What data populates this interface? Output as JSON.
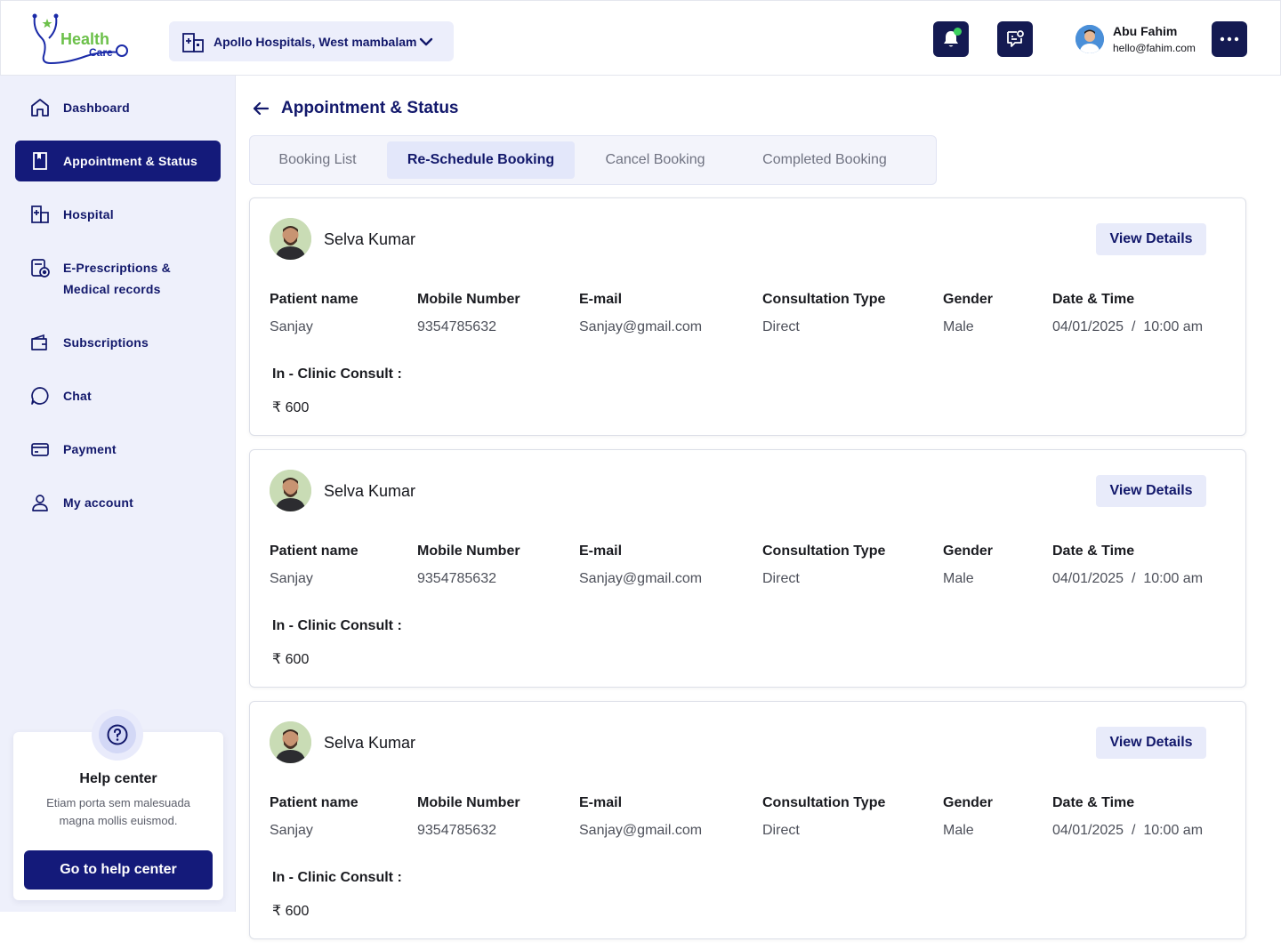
{
  "brand": {
    "name_line1": "Health",
    "name_line2": "Care"
  },
  "header": {
    "hospital": "Apollo Hospitals, West mambalam",
    "user_name": "Abu Fahim",
    "user_email": "hello@fahim.com"
  },
  "sidebar": {
    "items": [
      {
        "label": "Dashboard",
        "icon": "home-icon"
      },
      {
        "label": "Appointment & Status",
        "icon": "bookmark-icon",
        "active": true
      },
      {
        "label": "Hospital",
        "icon": "hospital-icon"
      },
      {
        "label": "E-Prescriptions & Medical records",
        "icon": "prescription-icon"
      },
      {
        "label": "Subscriptions",
        "icon": "wallet-icon"
      },
      {
        "label": "Chat",
        "icon": "chat-icon"
      },
      {
        "label": "Payment",
        "icon": "card-icon"
      },
      {
        "label": "My account",
        "icon": "user-icon"
      }
    ],
    "help": {
      "title": "Help center",
      "description": "Etiam porta sem malesuada magna mollis euismod.",
      "button": "Go to help center"
    }
  },
  "main": {
    "title": "Appointment & Status",
    "tabs": [
      {
        "label": "Booking List"
      },
      {
        "label": "Re-Schedule Booking",
        "active": true
      },
      {
        "label": "Cancel Booking"
      },
      {
        "label": "Completed Booking"
      }
    ],
    "labels": {
      "patient_name": "Patient name",
      "mobile": "Mobile Number",
      "email": "E-mail",
      "consult_type": "Consultation Type",
      "gender": "Gender",
      "datetime": "Date & Time",
      "clinic_consult": "In - Clinic Consult :",
      "view_details": "View Details",
      "currency": "₹"
    },
    "bookings": [
      {
        "doctor": "Selva Kumar",
        "patient_name": "Sanjay",
        "mobile": "9354785632",
        "email": "Sanjay@gmail.com",
        "consult_type": "Direct",
        "gender": "Male",
        "date": "04/01/2025",
        "time": "10:00 am",
        "fee": "600"
      },
      {
        "doctor": "Selva Kumar",
        "patient_name": "Sanjay",
        "mobile": "9354785632",
        "email": "Sanjay@gmail.com",
        "consult_type": "Direct",
        "gender": "Male",
        "date": "04/01/2025",
        "time": "10:00 am",
        "fee": "600"
      },
      {
        "doctor": "Selva Kumar",
        "patient_name": "Sanjay",
        "mobile": "9354785632",
        "email": "Sanjay@gmail.com",
        "consult_type": "Direct",
        "gender": "Male",
        "date": "04/01/2025",
        "time": "10:00 am",
        "fee": "600"
      }
    ]
  },
  "colors": {
    "primary": "#141a7a",
    "accent_green": "#6cc04a",
    "sidebar_bg": "#eef0fb"
  }
}
